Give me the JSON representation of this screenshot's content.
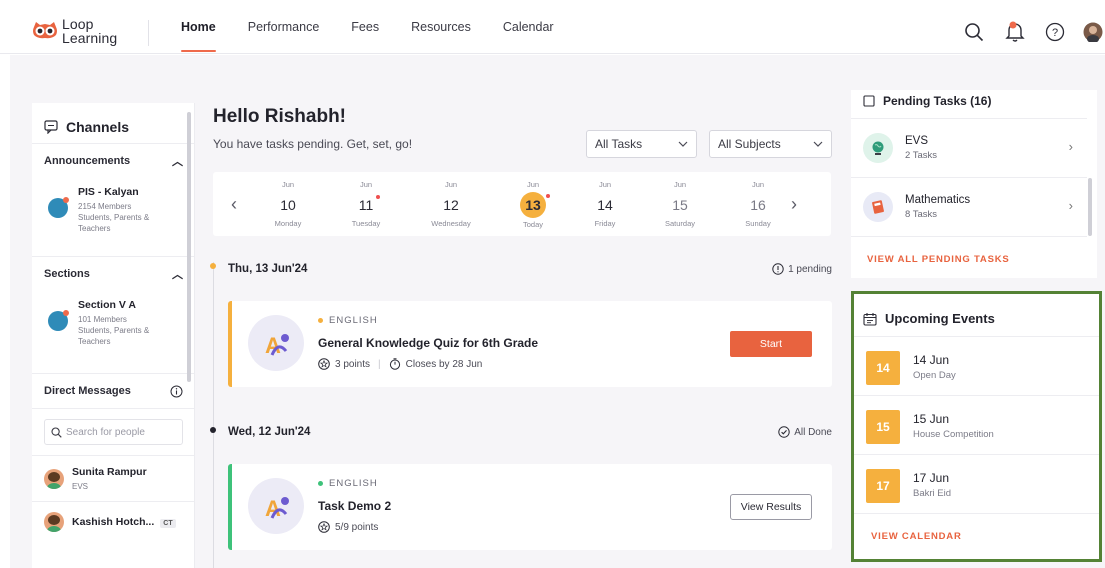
{
  "app": {
    "logo_line1": "Loop",
    "logo_line2": "Learning"
  },
  "nav": {
    "items": [
      "Home",
      "Performance",
      "Fees",
      "Resources",
      "Calendar"
    ],
    "active": "Home"
  },
  "header_icons": [
    "search-icon",
    "bell-icon",
    "help-icon",
    "profile-avatar"
  ],
  "sidebar": {
    "title": "Channels",
    "announcements": {
      "heading": "Announcements",
      "channel": {
        "name": "PIS - Kalyan",
        "members": "2154 Members",
        "desc_line1": "Students, Parents &",
        "desc_line2": "Teachers"
      }
    },
    "sections": {
      "heading": "Sections",
      "channel": {
        "name": "Section V A",
        "members": "101 Members",
        "desc_line1": "Students, Parents &",
        "desc_line2": "Teachers"
      }
    },
    "direct_messages": {
      "heading": "Direct Messages",
      "search_placeholder": "Search for people",
      "people": [
        {
          "name": "Sunita Rampur",
          "sub": "EVS"
        },
        {
          "name": "Kashish Hotch...",
          "tag": "CT"
        }
      ]
    }
  },
  "main": {
    "greeting": "Hello Rishabh!",
    "subtitle": "You have tasks pending. Get, set, go!",
    "filters": {
      "tasks": "All Tasks",
      "subjects": "All Subjects"
    },
    "calendar": {
      "days": [
        {
          "mon": "Jun",
          "num": "10",
          "name": "Monday",
          "dot": false,
          "today": false,
          "muted": false
        },
        {
          "mon": "Jun",
          "num": "11",
          "name": "Tuesday",
          "dot": true,
          "today": false,
          "muted": false
        },
        {
          "mon": "Jun",
          "num": "12",
          "name": "Wednesday",
          "dot": false,
          "today": false,
          "muted": false
        },
        {
          "mon": "Jun",
          "num": "13",
          "name": "Today",
          "dot": true,
          "today": true,
          "muted": false
        },
        {
          "mon": "Jun",
          "num": "14",
          "name": "Friday",
          "dot": false,
          "today": false,
          "muted": false
        },
        {
          "mon": "Jun",
          "num": "15",
          "name": "Saturday",
          "dot": false,
          "today": false,
          "muted": true
        },
        {
          "mon": "Jun",
          "num": "16",
          "name": "Sunday",
          "dot": false,
          "today": false,
          "muted": true
        }
      ]
    },
    "groups": [
      {
        "date": "Thu, 13 Jun'24",
        "status": "1 pending",
        "task": {
          "subject": "ENGLISH",
          "title": "General Knowledge Quiz for 6th Grade",
          "points": "3 points",
          "closes": "Closes by 28 Jun",
          "action": "Start"
        }
      },
      {
        "date": "Wed, 12 Jun'24",
        "status": "All Done",
        "task": {
          "subject": "ENGLISH",
          "title": "Task Demo 2",
          "points": "5/9 points",
          "action": "View Results"
        }
      }
    ]
  },
  "pending": {
    "heading": "Pending Tasks (16)",
    "items": [
      {
        "name": "EVS",
        "count": "2 Tasks"
      },
      {
        "name": "Mathematics",
        "count": "8 Tasks"
      }
    ],
    "link": "VIEW ALL PENDING TASKS"
  },
  "events": {
    "heading": "Upcoming Events",
    "items": [
      {
        "day": "14",
        "date": "14 Jun",
        "name": "Open Day"
      },
      {
        "day": "15",
        "date": "15 Jun",
        "name": "House Competition"
      },
      {
        "day": "17",
        "date": "17 Jun",
        "name": "Bakri Eid"
      }
    ],
    "link": "VIEW CALENDAR"
  },
  "colors": {
    "accent": "#e8633f",
    "today": "#f5b03e",
    "pending_bar": "#f5b03e",
    "done_bar": "#3ec27a",
    "highlight_border": "#548235"
  }
}
